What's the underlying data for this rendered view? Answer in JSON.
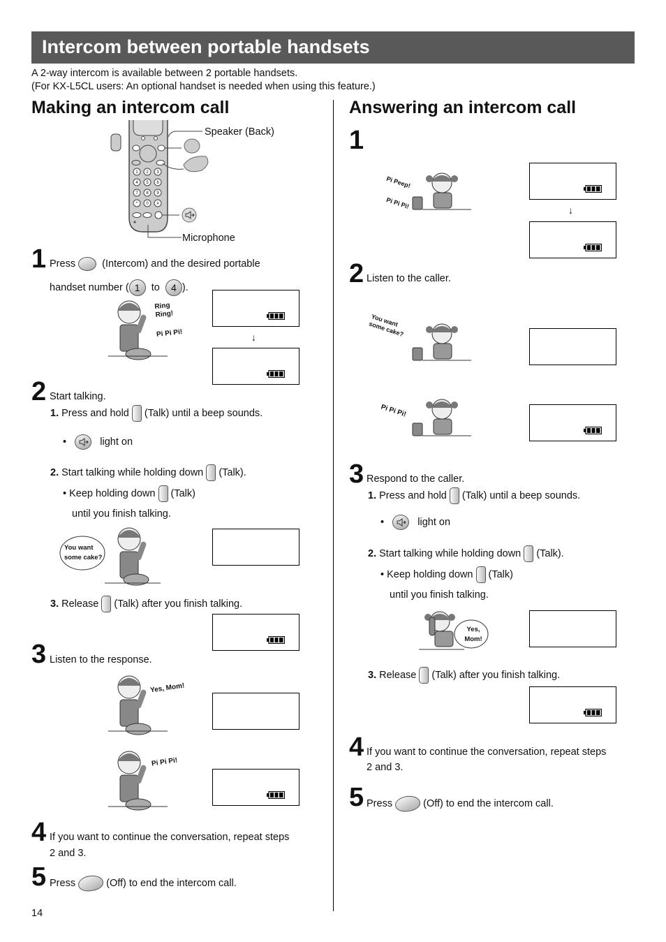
{
  "header": {
    "title": "Intercom between portable handsets"
  },
  "intro": {
    "line1": "A 2-way intercom is available between 2 portable handsets.",
    "line2": "(For KX-L5CL users: An optional handset is needed when using this feature.)"
  },
  "making": {
    "title": "Making an intercom call",
    "diagram": {
      "label_speaker": "Speaker (Back)",
      "label_microphone": "Microphone",
      "keypad": [
        "1",
        "2",
        "3",
        "4",
        "5",
        "6",
        "7",
        "8",
        "9",
        "*",
        "0",
        "#"
      ]
    },
    "step1": {
      "num": "1",
      "press": "Press",
      "rest": "(Intercom) and the desired portable",
      "line2a": "handset number (",
      "key_from": "1",
      "to": "to",
      "key_to": "4",
      "line2b": ").",
      "sfx1": "Ring Ring!",
      "sfx2": "Pi Pi Pi!"
    },
    "step2": {
      "num": "2",
      "text": "Start talking.",
      "sub1_num": "1.",
      "sub1_a": "Press and hold",
      "sub1_b": "(Talk) until a beep sounds.",
      "light": "light on",
      "sub2_num": "2.",
      "sub2_a": "Start talking while holding down",
      "sub2_b": "(Talk).",
      "keep_a": "Keep holding down",
      "keep_b": "(Talk)",
      "keep_c": "until you finish talking.",
      "bubble": "You want some cake?",
      "sub3_num": "3.",
      "sub3_a": "Release",
      "sub3_b": "(Talk) after you finish talking."
    },
    "step3": {
      "num": "3",
      "text": "Listen to the response.",
      "sfx1": "Yes, Mom!",
      "sfx2": "Pi Pi Pi!"
    },
    "step4": {
      "num": "4",
      "line1": "If you want to continue the conversation, repeat steps",
      "line2": "2 and 3."
    },
    "step5": {
      "num": "5",
      "press": "Press",
      "rest": "(Off) to end the intercom call."
    }
  },
  "answering": {
    "title": "Answering an intercom call",
    "step1": {
      "num": "1",
      "sfx1": "Pi Peep!",
      "sfx2": "Pi Pi Pi!"
    },
    "step2": {
      "num": "2",
      "text": "Listen to the caller.",
      "sfx1": "You want some cake?",
      "sfx2": "Pi Pi Pi!"
    },
    "step3": {
      "num": "3",
      "text": "Respond to the caller.",
      "sub1_num": "1.",
      "sub1_a": "Press and hold",
      "sub1_b": "(Talk) until a beep sounds.",
      "light": "light on",
      "sub2_num": "2.",
      "sub2_a": "Start talking while holding down",
      "sub2_b": "(Talk).",
      "keep_a": "Keep holding down",
      "keep_b": "(Talk)",
      "keep_c": "until you finish talking.",
      "bubble": "Yes, Mom!",
      "sub3_num": "3.",
      "sub3_a": "Release",
      "sub3_b": "(Talk) after you finish talking."
    },
    "step4": {
      "num": "4",
      "line1": "If you want to continue the conversation, repeat steps",
      "line2": "2 and 3."
    },
    "step5": {
      "num": "5",
      "press": "Press",
      "rest": "(Off) to end the intercom call."
    }
  },
  "footer": {
    "page_number": "14"
  },
  "icons": {
    "arrow_down": "↓",
    "bullet": "•"
  },
  "colors": {
    "banner": "#595959",
    "button_gray": "#bbbbbb"
  }
}
